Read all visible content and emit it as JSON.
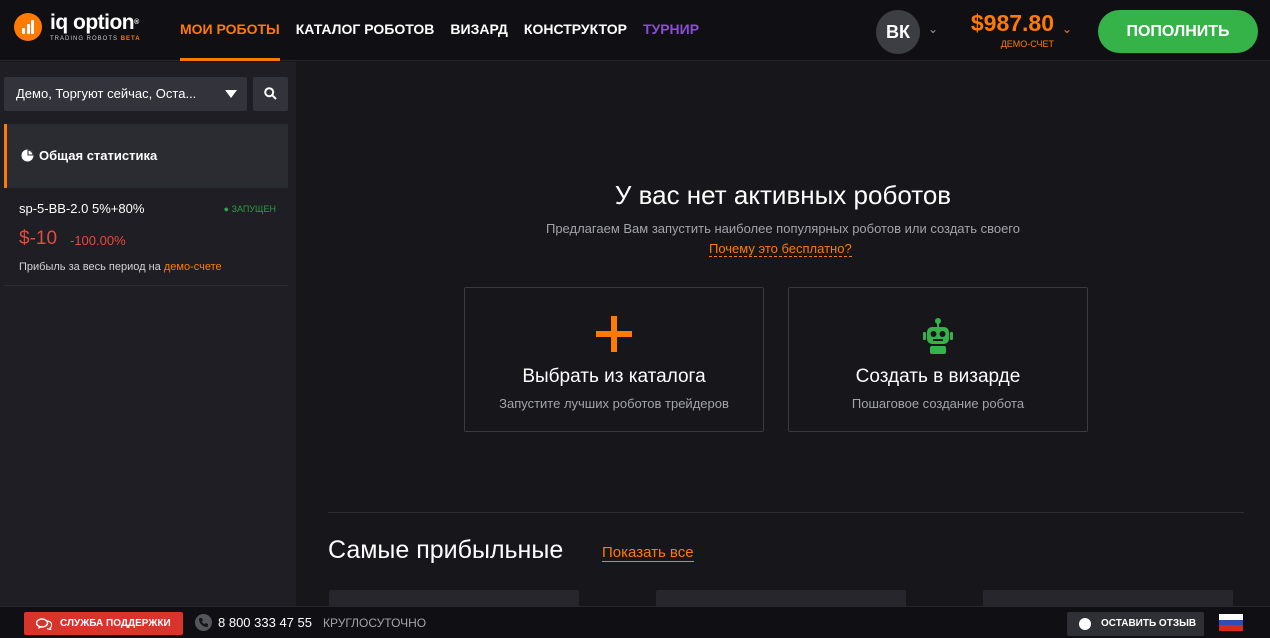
{
  "brand": {
    "name": "iq option",
    "sub": "TRADING ROBOTS",
    "sub_badge": "BETA",
    "accent": "#ff7a00"
  },
  "nav": {
    "items": [
      {
        "label": "МОИ РОБОТЫ"
      },
      {
        "label": "КАТАЛОГ РОБОТОВ"
      },
      {
        "label": "ВИЗАРД"
      },
      {
        "label": "КОНСТРУКТОР"
      },
      {
        "label": "ТУРНИР"
      }
    ]
  },
  "account": {
    "avatar_initials": "ВК",
    "balance": "$987.80",
    "balance_label": "ДЕМО-СЧЕТ",
    "deposit_label": "ПОПОЛНИТЬ",
    "deposit_color": "#35b349"
  },
  "sidebar": {
    "filter_value": "Демо, Торгуют сейчас, Оста...",
    "stats_label": "Общая статистика",
    "robot": {
      "name": "sp-5-BB-2.0 5%+80%",
      "status": "ЗАПУЩЕН",
      "profit": "$-10",
      "profit_pct": "-100.00%",
      "period_text": "Прибыль за весь период на",
      "period_link": "демо-счете",
      "loss_color": "#e34b3c"
    }
  },
  "main": {
    "empty_title": "У вас нет активных роботов",
    "empty_subtitle": "Предлагаем Вам запустить наиболее популярных роботов или создать своего",
    "why_free_link": "Почему это бесплатно?",
    "cards": [
      {
        "icon": "plus-icon",
        "title": "Выбрать из каталога",
        "subtitle": "Запустите лучших роботов трейдеров"
      },
      {
        "icon": "robot-icon",
        "title": "Создать в визарде",
        "subtitle": "Пошаговое создание робота"
      }
    ],
    "most_profitable_title": "Самые прибыльные",
    "show_all_link": "Показать все"
  },
  "footer": {
    "support_label": "СЛУЖБА ПОДДЕРЖКИ",
    "phone": "8 800 333 47 55",
    "hours": "КРУГЛОСУТОЧНО",
    "feedback_label": "ОСТАВИТЬ ОТЗЫВ",
    "language_flag": "flag-ru-icon"
  }
}
